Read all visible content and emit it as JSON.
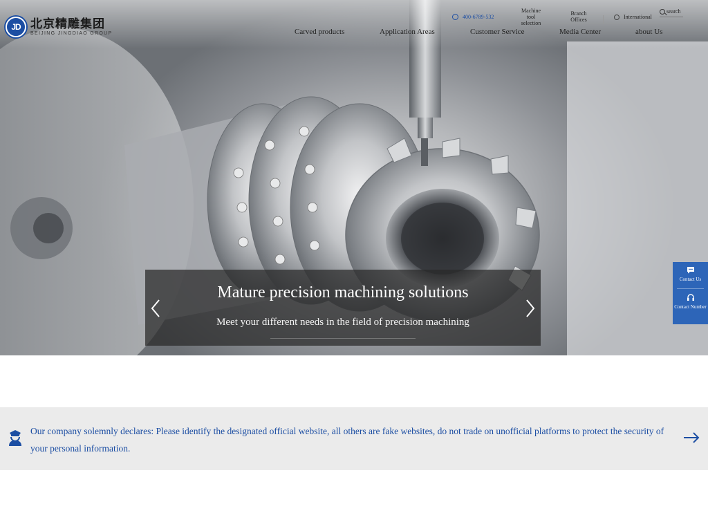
{
  "logo": {
    "mark": "JD",
    "name_cn": "北京精雕集团",
    "name_en": "BEIJING JINGDIAO GROUP"
  },
  "topbar": {
    "phone": "400-6789-532",
    "machine_tool_selection": "Machine tool selection",
    "branch_offices": "Branch Offices",
    "international": "International",
    "search": "search"
  },
  "nav": {
    "items": [
      "Carved products",
      "Application Areas",
      "Customer Service",
      "Media Center",
      "about Us"
    ]
  },
  "banner": {
    "title": "Mature precision machining solutions",
    "subtitle": "Meet your different needs in the field of precision machining"
  },
  "float_contact": {
    "contact_us": "Contact Us",
    "contact_number": "Contact Number"
  },
  "notice": {
    "text": "Our company solemnly declares: Please identify the designated official website, all others are fake websites, do not trade on unofficial platforms to protect the security of your personal information."
  },
  "colors": {
    "brand_blue": "#1c4ea3",
    "float_blue": "#2d65b8",
    "notice_bg": "#ebebeb"
  }
}
